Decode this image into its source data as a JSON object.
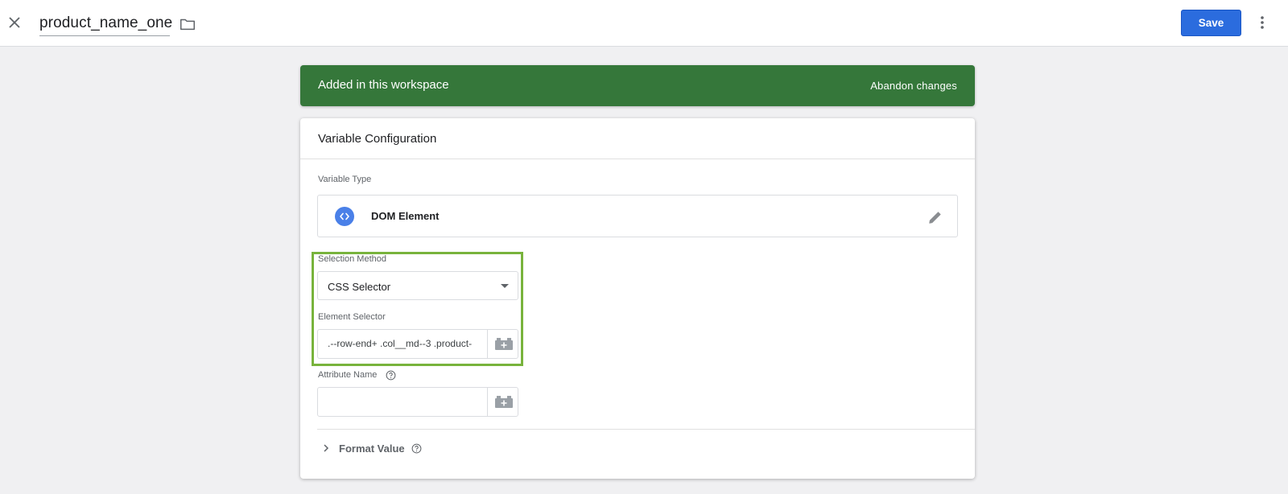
{
  "header": {
    "variable_name": "product_name_one",
    "save_label": "Save"
  },
  "banner": {
    "message": "Added in this workspace",
    "action_label": "Abandon changes",
    "color": "#35773a"
  },
  "card": {
    "title": "Variable Configuration",
    "variable_type": {
      "label": "Variable Type",
      "value": "DOM Element",
      "icon": "code-brackets-icon"
    },
    "selection_method": {
      "label": "Selection Method",
      "value": "CSS Selector"
    },
    "element_selector": {
      "label": "Element Selector",
      "value": ".--row-end+ .col__md--3 .product-"
    },
    "attribute_name": {
      "label": "Attribute Name",
      "value": ""
    },
    "format_value": {
      "label": "Format Value"
    }
  },
  "colors": {
    "accent": "#2b6cde",
    "highlight_border": "#78b33c"
  }
}
